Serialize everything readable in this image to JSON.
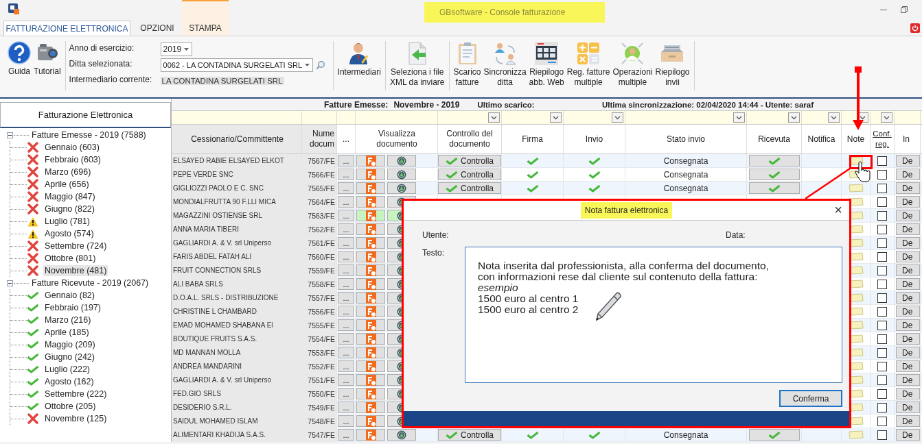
{
  "window": {
    "title": "GBsoftware - Console fatturazione"
  },
  "tabs": [
    {
      "label": "FATTURAZIONE ELETTRONICA",
      "selected": true,
      "kind": "normal"
    },
    {
      "label": "OPZIONI",
      "selected": false,
      "kind": "normal"
    },
    {
      "label": "STAMPA",
      "selected": false,
      "kind": "context"
    }
  ],
  "ribbon": {
    "left_buttons": [
      {
        "label": "Guida",
        "kind": "help"
      },
      {
        "label": "Tutorial",
        "kind": "camera"
      }
    ],
    "fields": [
      {
        "label": "Anno di esercizio:",
        "value": "2019",
        "kind": "select"
      },
      {
        "label": "Ditta selezionata:",
        "value": "0062 - LA CONTADINA SURGELATI SRL",
        "kind": "select_search"
      },
      {
        "label": "Intermediario corrente:",
        "value": "LA CONTADINA SURGELATI SRL",
        "kind": "text"
      }
    ],
    "button_groups": [
      [
        {
          "label": "Intermediari",
          "kind": "person"
        }
      ],
      [
        {
          "label": "Seleziona i file\nXML da inviare",
          "kind": "import"
        }
      ],
      [
        {
          "label": "Scarico\nfatture",
          "kind": "clipboard"
        },
        {
          "label": "Sincronizza\nditta",
          "kind": "sync"
        },
        {
          "label": "Riepilogo\nabb. Web",
          "kind": "grid"
        },
        {
          "label": "Reg. fatture\nmultiple",
          "kind": "calc"
        },
        {
          "label": "Operazioni\nmultiple",
          "kind": "operator"
        },
        {
          "label": "Riepilogo\ninvii",
          "kind": "tray"
        }
      ]
    ]
  },
  "sidebar": {
    "title": "Fatturazione Elettronica",
    "groups": [
      {
        "label": "Fatture Emesse - 2019 (7588)",
        "expanded": true,
        "children": [
          {
            "label": "Gennaio (603)",
            "kind": "error",
            "selected": false
          },
          {
            "label": "Febbraio (603)",
            "kind": "error",
            "selected": false
          },
          {
            "label": "Marzo (696)",
            "kind": "error",
            "selected": false
          },
          {
            "label": "Aprile (656)",
            "kind": "error",
            "selected": false
          },
          {
            "label": "Maggio (847)",
            "kind": "error",
            "selected": false
          },
          {
            "label": "Giugno (822)",
            "kind": "error",
            "selected": false
          },
          {
            "label": "Luglio (781)",
            "kind": "warning",
            "selected": false
          },
          {
            "label": "Agosto (574)",
            "kind": "warning",
            "selected": false
          },
          {
            "label": "Settembre (724)",
            "kind": "error",
            "selected": false
          },
          {
            "label": "Ottobre (801)",
            "kind": "error",
            "selected": false
          },
          {
            "label": "Novembre (481)",
            "kind": "error",
            "selected": true
          }
        ]
      },
      {
        "label": "Fatture Ricevute - 2019 (2067)",
        "expanded": true,
        "children": [
          {
            "label": "Gennaio (82)",
            "kind": "ok",
            "selected": false
          },
          {
            "label": "Febbraio (197)",
            "kind": "ok",
            "selected": false
          },
          {
            "label": "Marzo (216)",
            "kind": "ok",
            "selected": false
          },
          {
            "label": "Aprile (185)",
            "kind": "ok",
            "selected": false
          },
          {
            "label": "Maggio (209)",
            "kind": "ok",
            "selected": false
          },
          {
            "label": "Giugno (242)",
            "kind": "ok",
            "selected": false
          },
          {
            "label": "Luglio (222)",
            "kind": "ok",
            "selected": false
          },
          {
            "label": "Agosto (162)",
            "kind": "ok",
            "selected": false
          },
          {
            "label": "Settembre (222)",
            "kind": "ok",
            "selected": false
          },
          {
            "label": "Ottobre (205)",
            "kind": "ok",
            "selected": false
          },
          {
            "label": "Novembre (125)",
            "kind": "error",
            "selected": false
          }
        ]
      }
    ]
  },
  "info_bar": {
    "section": "Fatture Emesse:",
    "period": "Novembre - 2019",
    "last_download": "Ultimo scarico:",
    "last_sync": "Ultima sincronizzazione: 02/04/2020 14:44 - Utente: saraf"
  },
  "table": {
    "columns": [
      {
        "label": "Cessionario/Committente",
        "filter": false,
        "kind": "text"
      },
      {
        "label": "Nume\ndocum",
        "filter": false,
        "kind": "text"
      },
      {
        "label": "...",
        "filter": false,
        "kind": "text"
      },
      {
        "label": "Visualizza\ndocumento",
        "filter": false,
        "kind": "text"
      },
      {
        "label": "Controllo del\ndocumento",
        "filter": true,
        "kind": "text"
      },
      {
        "label": "Firma",
        "filter": true,
        "kind": "text"
      },
      {
        "label": "Invio",
        "filter": true,
        "kind": "text"
      },
      {
        "label": "Stato invio",
        "filter": true,
        "kind": "text"
      },
      {
        "label": "Ricevuta",
        "filter": true,
        "kind": "text"
      },
      {
        "label": "Notifica",
        "filter": true,
        "kind": "text"
      },
      {
        "label": "Note",
        "filter": true,
        "kind": "text"
      },
      {
        "label": "Conf.\nreg.",
        "filter": true,
        "kind": "link"
      },
      {
        "label": "In",
        "filter": false,
        "kind": "text"
      }
    ],
    "rows": [
      {
        "name": "ELSAYED RABIE ELSAYED ELKOT",
        "number": "7567/FE",
        "more": "...",
        "highlighted": false,
        "controllo": "Controlla",
        "firma": true,
        "invio": true,
        "stato": "Consegnata",
        "ricevuta": true,
        "note": true,
        "confirmed": false,
        "action": "De"
      },
      {
        "name": "PEPE VERDE SNC",
        "number": "7566/FE",
        "more": "...",
        "highlighted": false,
        "controllo": "Controlla",
        "firma": true,
        "invio": true,
        "stato": "Consegnata",
        "ricevuta": true,
        "note": true,
        "confirmed": false,
        "action": "De"
      },
      {
        "name": "GIGLIOZZI PAOLO E C. SNC",
        "number": "7565/FE",
        "more": "...",
        "highlighted": false,
        "controllo": "Controlla",
        "firma": true,
        "invio": true,
        "stato": "Consegnata",
        "ricevuta": true,
        "note": true,
        "confirmed": false,
        "action": "De"
      },
      {
        "name": "MONDIALFRUTTA 90 F.LLI MICA",
        "number": "7564/FE",
        "more": "...",
        "highlighted": false,
        "note": true,
        "confirmed": false,
        "action": "De"
      },
      {
        "name": "MAGAZZINI OSTIENSE SRL",
        "number": "7563/FE",
        "more": "...",
        "highlighted": true,
        "note": true,
        "confirmed": false,
        "action": "De"
      },
      {
        "name": "ANNA MARIA TIBERI",
        "number": "7562/FE",
        "more": "...",
        "highlighted": false,
        "note": true,
        "confirmed": false,
        "action": "De"
      },
      {
        "name": "GAGLIARDI A. & V. srl Uniperso",
        "number": "7561/FE",
        "more": "...",
        "highlighted": false,
        "note": true,
        "confirmed": false,
        "action": "De"
      },
      {
        "name": "FARIS ABDEL FATAH ALI",
        "number": "7560/FE",
        "more": "...",
        "highlighted": false,
        "note": true,
        "confirmed": false,
        "action": "De"
      },
      {
        "name": "FRUIT CONNECTION SRLS",
        "number": "7559/FE",
        "more": "...",
        "highlighted": false,
        "note": true,
        "confirmed": false,
        "action": "De"
      },
      {
        "name": "ALI BABA SRLS",
        "number": "7558/FE",
        "more": "...",
        "highlighted": false,
        "note": true,
        "confirmed": false,
        "action": "De"
      },
      {
        "name": "D.O.A.L. SRLS - DISTRIBUZIONE",
        "number": "7557/FE",
        "more": "...",
        "highlighted": false,
        "note": true,
        "confirmed": false,
        "action": "De"
      },
      {
        "name": "CHRISTINE L CHAMBARD",
        "number": "7556/FE",
        "more": "...",
        "highlighted": false,
        "note": true,
        "confirmed": false,
        "action": "De"
      },
      {
        "name": "EMAD MOHAMED SHABANA El",
        "number": "7555/FE",
        "more": "...",
        "highlighted": false,
        "note": true,
        "confirmed": false,
        "action": "De"
      },
      {
        "name": "BOUTIQUE FRUITS S.A.S.",
        "number": "7554/FE",
        "more": "...",
        "highlighted": false,
        "note": true,
        "confirmed": false,
        "action": "De"
      },
      {
        "name": "MD MANNAN MOLLA",
        "number": "7553/FE",
        "more": "...",
        "highlighted": false,
        "note": true,
        "confirmed": false,
        "action": "De"
      },
      {
        "name": "ANDREA MANDARINI",
        "number": "7552/FE",
        "more": "...",
        "highlighted": false,
        "note": true,
        "confirmed": false,
        "action": "De"
      },
      {
        "name": "GAGLIARDI A. & V. srl Uniperso",
        "number": "7551/FE",
        "more": "...",
        "highlighted": false,
        "note": true,
        "confirmed": false,
        "action": "De"
      },
      {
        "name": "FED.GIO SRLS",
        "number": "7550/FE",
        "more": "...",
        "highlighted": false,
        "note": true,
        "confirmed": false,
        "action": "De"
      },
      {
        "name": "DESIDERIO S.R.L.",
        "number": "7549/FE",
        "more": "...",
        "highlighted": false,
        "note": true,
        "confirmed": false,
        "action": "De"
      },
      {
        "name": "SAIDUL MOHAMED ISLAM",
        "number": "7548/FE",
        "more": "...",
        "highlighted": false,
        "note": true,
        "confirmed": false,
        "action": "De"
      },
      {
        "name": "ALIMENTARI KHADIJA S.A.S.",
        "number": "7547/FE",
        "more": "...",
        "highlighted": false,
        "controllo": "Controlla",
        "firma": true,
        "invio": true,
        "stato": "Consegnata",
        "ricevuta": true,
        "note": true,
        "confirmed": false,
        "action": "De"
      }
    ]
  },
  "dialog": {
    "title": "Nota fattura elettronica",
    "close": "×",
    "user_label": "Utente:",
    "date_label": "Data:",
    "text_label": "Testo:",
    "text": "Nota inserita dal professionista, alla conferma del documento,\ncon informazioni rese dal cliente sul contenuto della fattura:\n*esempio*\n1500 euro al centro 1\n1500 euro al centro 2",
    "confirm": "Conferma"
  }
}
